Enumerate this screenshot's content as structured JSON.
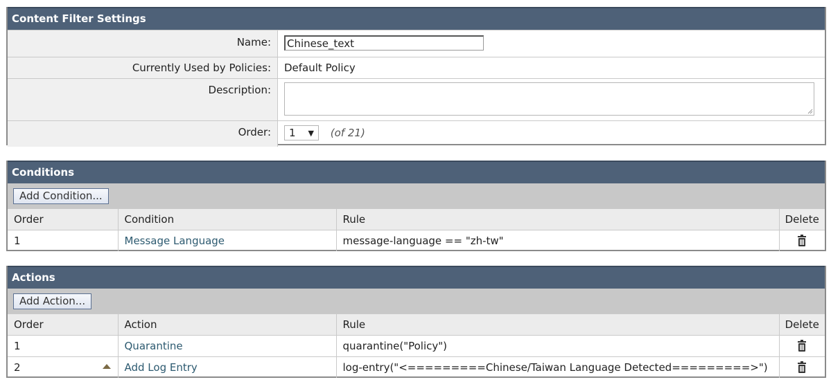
{
  "settings": {
    "title": "Content Filter Settings",
    "name_label": "Name:",
    "name_value": "Chinese_text",
    "policies_label": "Currently Used by Policies:",
    "policies_value": "Default Policy",
    "description_label": "Description:",
    "description_value": "",
    "order_label": "Order:",
    "order_value": "1",
    "order_of": "(of 21)"
  },
  "conditions": {
    "title": "Conditions",
    "add_button": "Add Condition...",
    "headers": {
      "order": "Order",
      "condition": "Condition",
      "rule": "Rule",
      "delete": "Delete"
    },
    "rows": [
      {
        "order": "1",
        "condition": "Message Language",
        "rule": "message-language == \"zh-tw\""
      }
    ]
  },
  "actions": {
    "title": "Actions",
    "add_button": "Add Action...",
    "headers": {
      "order": "Order",
      "action": "Action",
      "rule": "Rule",
      "delete": "Delete"
    },
    "rows": [
      {
        "order": "1",
        "action": "Quarantine",
        "rule": "quarantine(\"Policy\")"
      },
      {
        "order": "2",
        "action": "Add Log Entry",
        "rule": "log-entry(\"<=========Chinese/Taiwan Language Detected=========>\")"
      }
    ]
  },
  "colors": {
    "header_bg": "#4e6178",
    "link": "#2d5a70",
    "label_bg": "#f0f0f0"
  },
  "icons": {
    "delete": "trash-icon",
    "move_up": "move-up-arrow-icon",
    "dropdown": "dropdown-arrow-icon"
  }
}
